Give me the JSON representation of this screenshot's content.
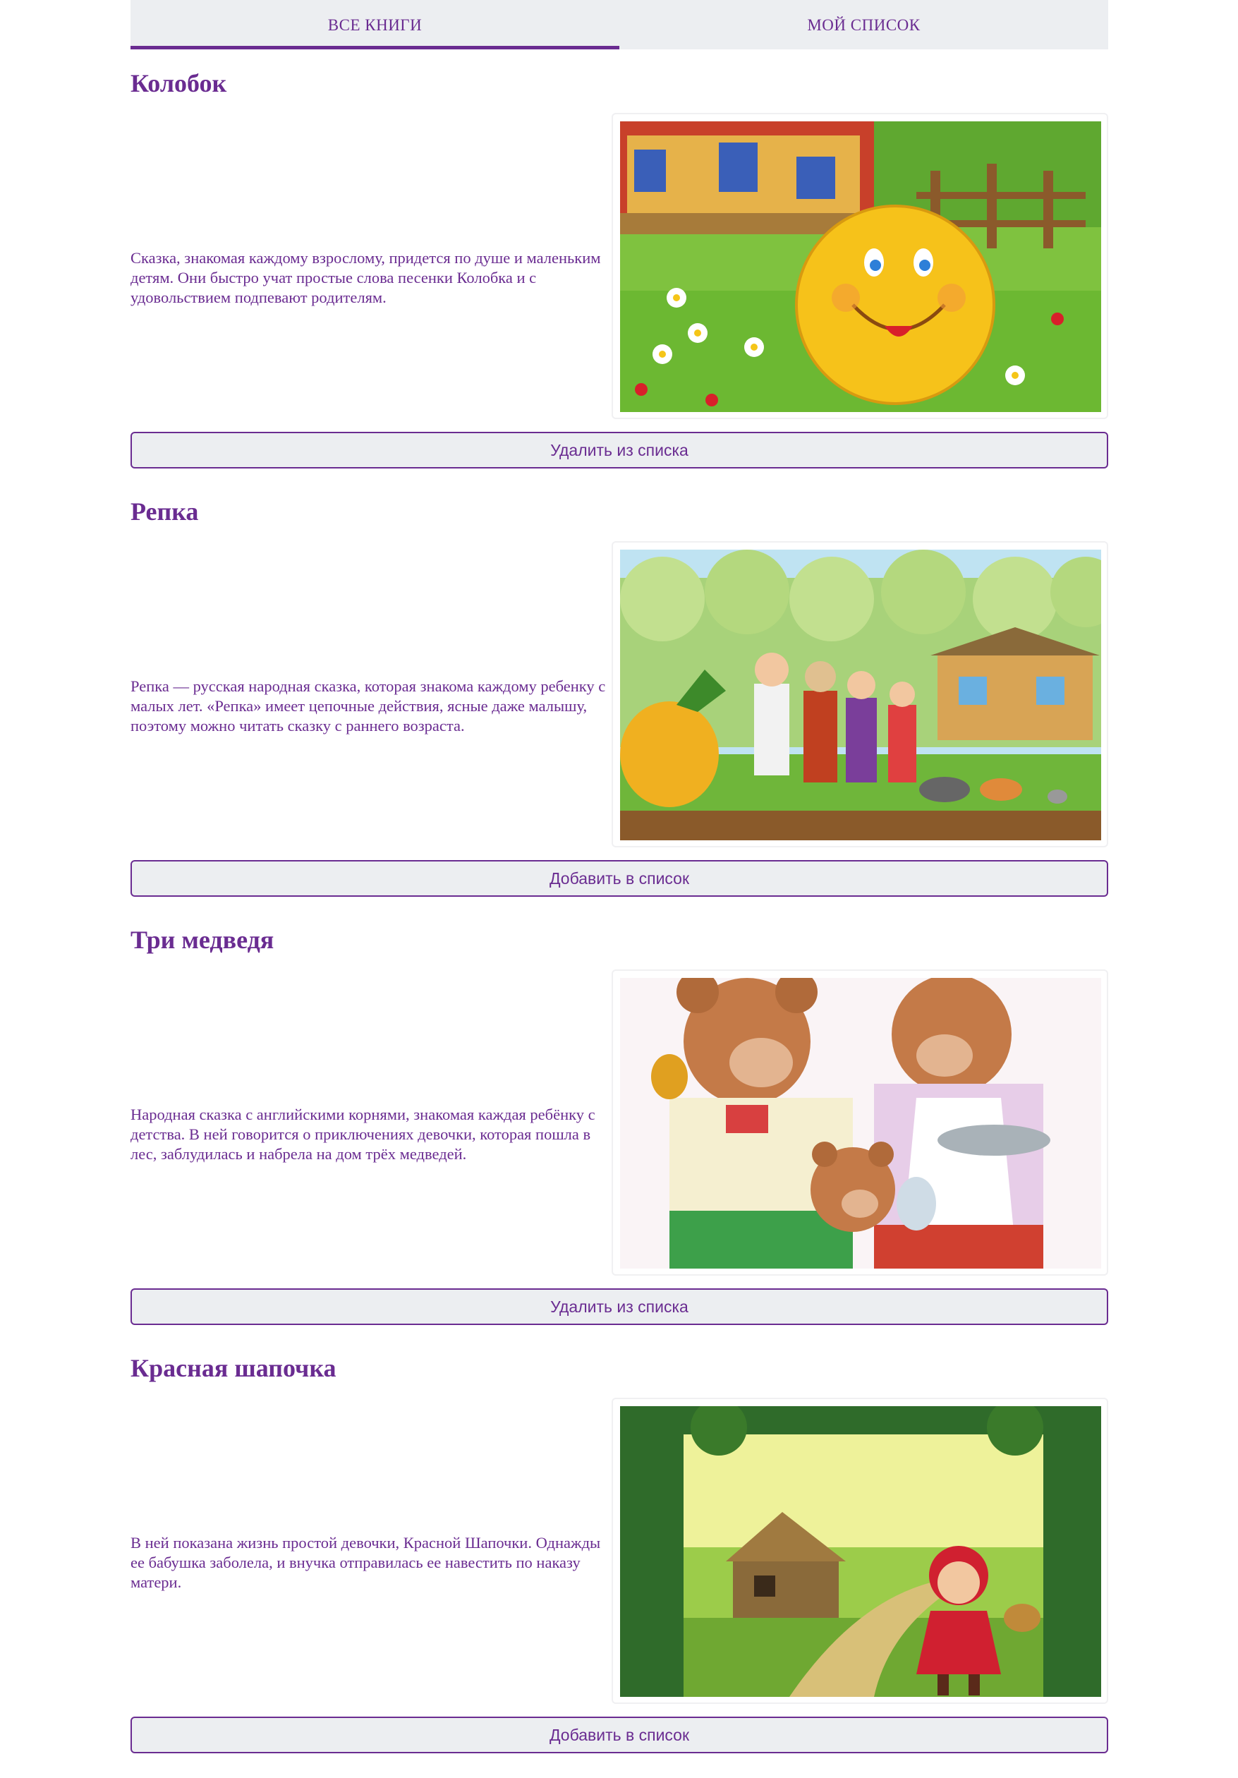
{
  "tabs": [
    {
      "label": "ВСЕ КНИГИ",
      "active": true
    },
    {
      "label": "МОЙ СПИСОК",
      "active": false
    }
  ],
  "books": [
    {
      "title": "Колобок",
      "description": "Сказка, знакомая каждому взрослому, придется по душе и маленьким детям. Они быстро учат простые слова песенки Колобка и с удовольствием подпевают родителям.",
      "button_label": "Удалить из списка",
      "image_icon": "kolobok-illustration"
    },
    {
      "title": "Репка",
      "description": "Репка — русская народная сказка, которая знакома каждому ребенку с малых лет. «Репка» имеет цепочные действия, ясные даже малышу, поэтому можно читать сказку с раннего возраста.",
      "button_label": "Добавить в список",
      "image_icon": "repka-illustration"
    },
    {
      "title": "Три медведя",
      "description": "Народная сказка с английскими корнями, знакомая каждая ребёнку с детства. В ней говорится о приключениях девочки, которая пошла в лес, заблудилась и набрела на дом трёх медведей.",
      "button_label": "Удалить из списка",
      "image_icon": "three-bears-illustration"
    },
    {
      "title": "Красная шапочка",
      "description": "В ней показана жизнь простой девочки, Красной Шапочки. Однажды ее бабушка заболела, и внучка отправилась ее навестить по наказу матери.",
      "button_label": "Добавить в список",
      "image_icon": "red-riding-hood-illustration"
    }
  ],
  "colors": {
    "accent": "#6a2c91",
    "tab_background": "#eceef1",
    "button_background": "#eceef1"
  }
}
